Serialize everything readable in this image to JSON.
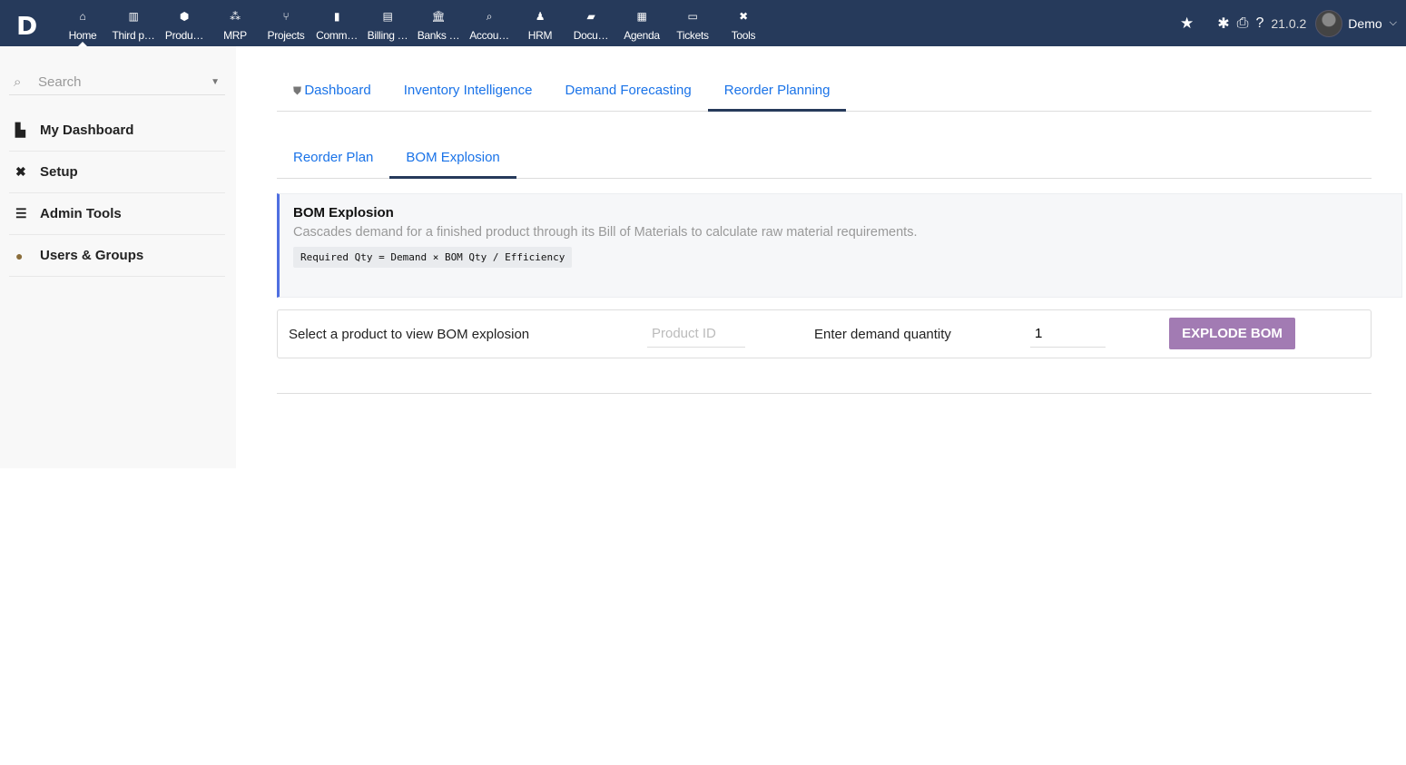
{
  "topbar": {
    "logo": "D",
    "nav": [
      {
        "label": "Home",
        "icon": "⌂"
      },
      {
        "label": "Third p…",
        "icon": "▥"
      },
      {
        "label": "Produ…",
        "icon": "⬢"
      },
      {
        "label": "MRP",
        "icon": "⁂"
      },
      {
        "label": "Projects",
        "icon": "⑂"
      },
      {
        "label": "Comm…",
        "icon": "▮"
      },
      {
        "label": "Billing …",
        "icon": "▤"
      },
      {
        "label": "Banks …",
        "icon": "🏛"
      },
      {
        "label": "Accou…",
        "icon": "⌕"
      },
      {
        "label": "HRM",
        "icon": "♟"
      },
      {
        "label": "Docu…",
        "icon": "▰"
      },
      {
        "label": "Agenda",
        "icon": "▦"
      },
      {
        "label": "Tickets",
        "icon": "▭"
      },
      {
        "label": "Tools",
        "icon": "✖"
      }
    ],
    "version": "21.0.2",
    "user": "Demo"
  },
  "sidebar": {
    "search_placeholder": "Search",
    "items": [
      {
        "label": "My Dashboard",
        "icon": "📊"
      },
      {
        "label": "Setup",
        "icon": "✖"
      },
      {
        "label": "Admin Tools",
        "icon": "☰"
      },
      {
        "label": "Users & Groups",
        "icon": "👤"
      }
    ]
  },
  "tabs": [
    "Dashboard",
    "Inventory Intelligence",
    "Demand Forecasting",
    "Reorder Planning"
  ],
  "subtabs": [
    "Reorder Plan",
    "BOM Explosion"
  ],
  "info": {
    "title": "BOM Explosion",
    "description": "Cascades demand for a finished product through its Bill of Materials to calculate raw material requirements.",
    "formula": "Required Qty = Demand × BOM Qty / Efficiency"
  },
  "form": {
    "select_label": "Select a product to view BOM explosion",
    "product_placeholder": "Product ID",
    "demand_label": "Enter demand quantity",
    "demand_value": "1",
    "button": "EXPLODE BOM"
  },
  "colors": {
    "topbar": "#263a5b",
    "accent": "#1a73e8",
    "button": "#a27bb3",
    "info_border": "#4f6fe0"
  }
}
